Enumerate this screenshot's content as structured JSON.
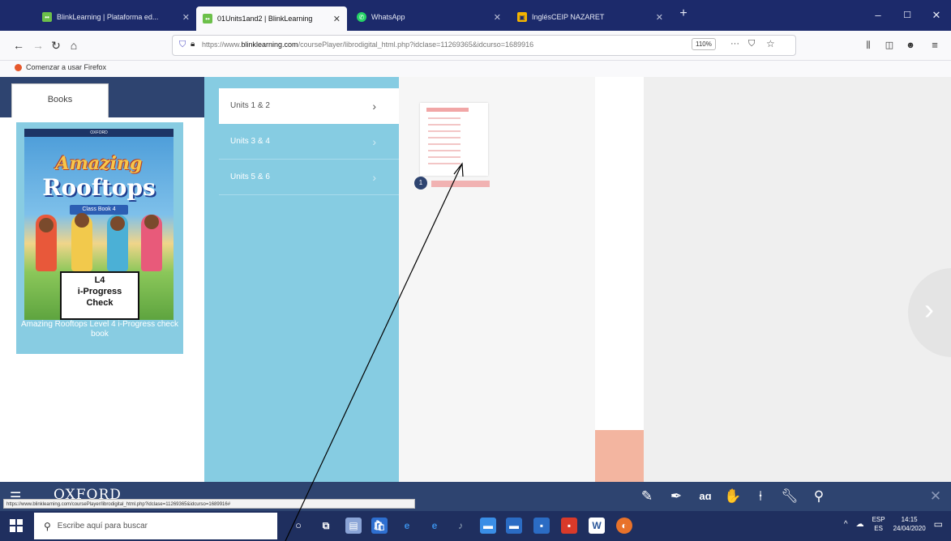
{
  "browser": {
    "tabs": [
      {
        "title": "BlinkLearning | Plataforma ed...",
        "icon": "blinklearning-favicon-icon",
        "active": false
      },
      {
        "title": "01Units1and2 | BlinkLearning",
        "icon": "blinklearning-favicon-icon",
        "active": true
      },
      {
        "title": "WhatsApp",
        "icon": "whatsapp-icon",
        "active": false
      },
      {
        "title": "InglésCEIP NAZARET",
        "icon": "classroom-icon",
        "active": false
      }
    ],
    "new_tab": "+",
    "url_prefix": "https://www.",
    "url_domain": "blinklearning.com",
    "url_rest": "/coursePlayer/librodigital_html.php?idclase=11269365&idcurso=1689916",
    "zoom": "110%",
    "bookmark": "Comenzar a usar Firefox"
  },
  "app": {
    "books_tab": "Books",
    "cover": {
      "publisher": "OXFORD",
      "title_line1": "Amazing",
      "title_line2": "Rooftops",
      "badge": "Class Book 4",
      "label_line1": "L4",
      "label_line2": "i-Progress",
      "label_line3": "Check"
    },
    "book_name": "Amazing Rooftops Level 4 i-Progress check book",
    "units": [
      {
        "label": "Units 1 & 2",
        "selected": true
      },
      {
        "label": "Units 3 & 4",
        "selected": false
      },
      {
        "label": "Units 5 & 6",
        "selected": false
      }
    ],
    "page_number": "1",
    "brand": "OXFORD",
    "status_url": "https://www.blinklearning.com/coursePlayer/librodigital_html.php?idclase=11269365&idcurso=1689916#"
  },
  "taskbar": {
    "search_placeholder": "Escribe aquí para buscar",
    "lang_top": "ESP",
    "lang_bottom": "ES",
    "time": "14:15",
    "date": "24/04/2020"
  },
  "colors": {
    "dark_navy": "#2e4470",
    "light_blue": "#86cce2",
    "tab_strip": "#1c2a6b",
    "salmon": "#f3b5a0"
  }
}
